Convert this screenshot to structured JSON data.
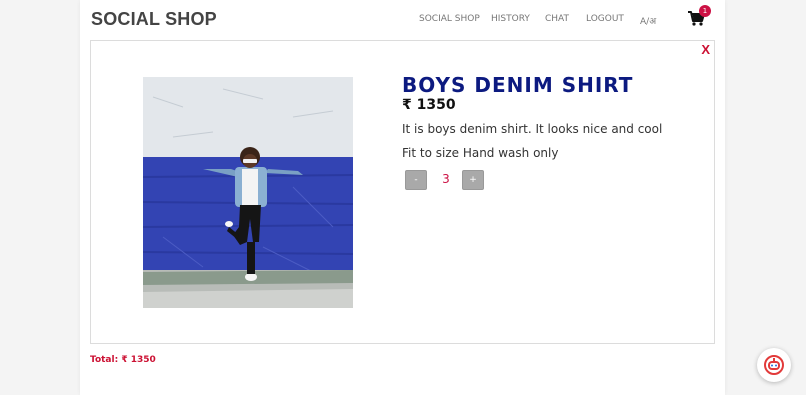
{
  "header": {
    "brand": "SOCIAL SHOP",
    "nav": [
      "SOCIAL SHOP",
      "HISTORY",
      "CHAT",
      "LOGOUT",
      "A/अ"
    ],
    "cart_count": "1",
    "cart_icon": "shopping-cart-icon"
  },
  "product": {
    "close_label": "X",
    "title": "BOYS DENIM SHIRT",
    "price": "₹ 1350",
    "description": "It is boys denim shirt. It looks nice and cool",
    "details": "Fit to size Hand wash only",
    "decrement_label": "-",
    "quantity": "3",
    "increment_label": "+",
    "image": "child-posing-against-blue-wall-photo"
  },
  "summary": {
    "total": "Total: ₹ 1350"
  },
  "chatbot": {
    "icon": "chat-bot-icon"
  },
  "colors": {
    "title": "#0c1a80",
    "accent": "#cc1133",
    "brand": "#444444"
  }
}
